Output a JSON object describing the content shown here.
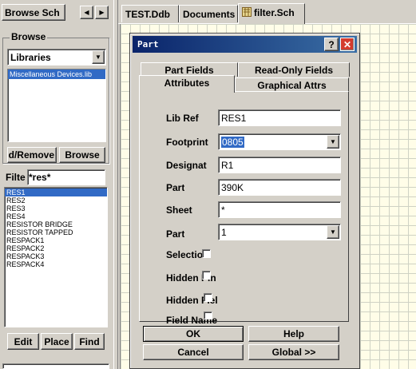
{
  "left_panel": {
    "tab_label": "Browse Sch",
    "browse_group": {
      "legend": "Browse",
      "dropdown_value": "Libraries",
      "library_item": "Miscellaneous Devices.lib",
      "remove_label": "d/Remove",
      "browse_label": "Browse"
    },
    "filter": {
      "label": "Filte",
      "value": "*res*"
    },
    "parts": [
      "RES1",
      "RES2",
      "RES3",
      "RES4",
      "RESISTOR BRIDGE",
      "RESISTOR TAPPED",
      "RESPACK1",
      "RESPACK2",
      "RESPACK3",
      "RESPACK4"
    ],
    "selected_part_index": 0,
    "buttons": {
      "edit": "Edit",
      "place": "Place",
      "find": "Find"
    }
  },
  "doc_tabs": [
    "TEST.Ddb",
    "Documents",
    "filter.Sch"
  ],
  "dialog": {
    "title": "Part",
    "tabs_back": [
      "Part Fields",
      "Read-Only Fields"
    ],
    "tabs_front": [
      "Attributes",
      "Graphical Attrs"
    ],
    "active_tab": "Attributes",
    "fields": {
      "lib_ref": {
        "label": "Lib Ref",
        "value": "RES1"
      },
      "footprint": {
        "label": "Footprint",
        "value": "0805"
      },
      "designator": {
        "label": "Designat",
        "value": "R1"
      },
      "part_type": {
        "label": "Part",
        "value": "390K"
      },
      "sheet": {
        "label": "Sheet",
        "value": "*"
      },
      "part_number": {
        "label": "Part",
        "value": "1"
      },
      "selection": {
        "label": "Selection",
        "checked": false
      },
      "hidden_pins": {
        "label": "Hidden Pin",
        "checked": false
      },
      "hidden_fields": {
        "label": "Hidden Fiel",
        "checked": false
      },
      "field_names": {
        "label": "Field Name",
        "checked": false
      }
    },
    "buttons": {
      "ok": "OK",
      "help": "Help",
      "cancel": "Cancel",
      "global": "Global >>"
    }
  },
  "colors": {
    "selection": "#316ac5",
    "titlebar_start": "#0a246a",
    "titlebar_end": "#3a6ea5",
    "sheet_background": "#fffde8",
    "close_button": "#d43c2e"
  }
}
